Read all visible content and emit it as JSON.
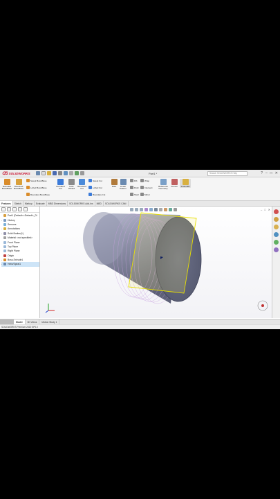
{
  "app": {
    "brand": "SOLIDWORKS",
    "document_title": "Part1 *",
    "search_placeholder": "Search SOLIDWORKS Help"
  },
  "window_buttons": [
    "?",
    "–",
    "□",
    "✕"
  ],
  "command_manager": {
    "large": [
      {
        "label": "Extruded Boss/Base",
        "color": "#d98c2b"
      },
      {
        "label": "Revolved Boss/Base",
        "color": "#d9a03b"
      },
      {
        "label": "Extruded Cut",
        "color": "#3b7bd9"
      },
      {
        "label": "Hole Wizard",
        "color": "#8a8a8a"
      },
      {
        "label": "Revolved Cut",
        "color": "#4a8ad9"
      },
      {
        "label": "Fillet",
        "color": "#b07a3a"
      },
      {
        "label": "Linear Pattern",
        "color": "#6a8ab0"
      },
      {
        "label": "Reference Geometry",
        "color": "#7aa0c8"
      },
      {
        "label": "Curves",
        "color": "#c06060"
      },
      {
        "label": "Instant3D",
        "color": "#d8b040"
      }
    ],
    "small": [
      {
        "label": "Swept Boss/Base",
        "color": "#d98c2b"
      },
      {
        "label": "Lofted Boss/Base",
        "color": "#d98c2b"
      },
      {
        "label": "Boundary Boss/Base",
        "color": "#d98c2b"
      },
      {
        "label": "Swept Cut",
        "color": "#3b7bd9"
      },
      {
        "label": "Lofted Cut",
        "color": "#3b7bd9"
      },
      {
        "label": "Boundary Cut",
        "color": "#3b7bd9"
      },
      {
        "label": "Rib",
        "color": "#888"
      },
      {
        "label": "Draft",
        "color": "#888"
      },
      {
        "label": "Shell",
        "color": "#888"
      },
      {
        "label": "Wrap",
        "color": "#888"
      },
      {
        "label": "Intersect",
        "color": "#888"
      },
      {
        "label": "Mirror",
        "color": "#888"
      }
    ]
  },
  "tabs": [
    "Features",
    "Sketch",
    "Markup",
    "Evaluate",
    "MBD Dimensions",
    "SOLIDWORKS Add-Ins",
    "MBD",
    "SOLIDWORKS CAM"
  ],
  "feature_tree": [
    {
      "label": "Part1 (Default<<Default>_Di",
      "icon": "part",
      "color": "#d8a040",
      "arrow": ""
    },
    {
      "label": "History",
      "icon": "history",
      "color": "#7a9ac0",
      "arrow": "›"
    },
    {
      "label": "Sensors",
      "icon": "sensor",
      "color": "#7ab0d8",
      "arrow": ""
    },
    {
      "label": "Annotations",
      "icon": "annotation",
      "color": "#d8b040",
      "arrow": "›"
    },
    {
      "label": "Solid Bodies(1)",
      "icon": "solid-body",
      "color": "#9090a8",
      "arrow": "›"
    },
    {
      "label": "Material <not specified>",
      "icon": "material",
      "color": "#a0a0a0",
      "arrow": ""
    },
    {
      "label": "Front Plane",
      "icon": "plane",
      "color": "#9ab8d8",
      "arrow": ""
    },
    {
      "label": "Top Plane",
      "icon": "plane",
      "color": "#9ab8d8",
      "arrow": ""
    },
    {
      "label": "Right Plane",
      "icon": "plane",
      "color": "#9ab8d8",
      "arrow": ""
    },
    {
      "label": "Origin",
      "icon": "origin",
      "color": "#c04040",
      "arrow": ""
    },
    {
      "label": "Boss-Extrude1",
      "icon": "extrude",
      "color": "#d98c2b",
      "arrow": "›"
    },
    {
      "label": "Helix/Spiral1",
      "icon": "helix",
      "color": "#6a8ab0",
      "arrow": "›",
      "selected": true
    }
  ],
  "bottom_tabs": [
    "Model",
    "3D Views",
    "Motion Study 1"
  ],
  "status_text": "SOLIDWORKS Premium 2020 SP0.0",
  "colors": {
    "accent": "#c8102e",
    "cylinder": "#8c8fa6",
    "helix": "#c8a0e0",
    "plane": "#f0e000"
  }
}
